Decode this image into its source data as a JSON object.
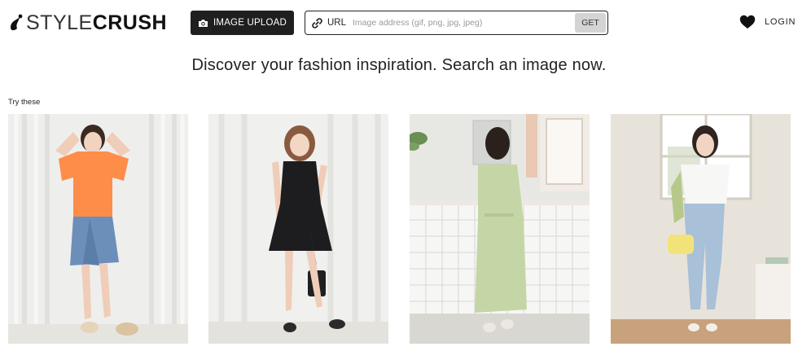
{
  "brand": {
    "name_part1": "STYLE",
    "name_part2": "CRUSH"
  },
  "upload": {
    "label": "IMAGE UPLOAD",
    "icon": "camera-icon"
  },
  "url_search": {
    "icon": "link-icon",
    "label": "URL",
    "placeholder": "Image address (gif, png, jpg, jpeg)",
    "value": "",
    "button_label": "GET"
  },
  "header_right": {
    "favorites_icon": "heart-icon",
    "login_label": "LOGIN"
  },
  "headline": "Discover your fashion inspiration. Search an image now.",
  "suggestions": {
    "label": "Try these",
    "items": [
      {
        "outfit": "orange t-shirt with denim wrap skirt"
      },
      {
        "outfit": "black sleeveless mini dress"
      },
      {
        "outfit": "sage green belted maxi dress"
      },
      {
        "outfit": "white t-shirt with light blue jeans"
      }
    ]
  },
  "colors": {
    "button_dark": "#1f1f1f",
    "get_button": "#d4d4d4",
    "text": "#222222"
  }
}
